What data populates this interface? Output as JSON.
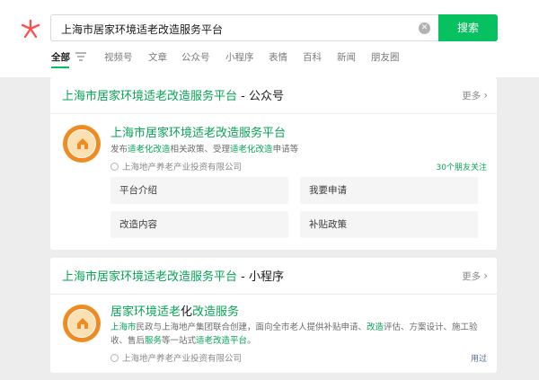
{
  "search": {
    "query": "上海市居家环境适老改造服务平台",
    "button_label": "搜索"
  },
  "tabs": [
    {
      "label": "全部",
      "active": true
    },
    {
      "label": "视频号"
    },
    {
      "label": "文章"
    },
    {
      "label": "公众号"
    },
    {
      "label": "小程序"
    },
    {
      "label": "表情"
    },
    {
      "label": "百科"
    },
    {
      "label": "新闻"
    },
    {
      "label": "朋友圈"
    }
  ],
  "official_account_card": {
    "header_highlight": "上海市居家环境适老改造服务平台",
    "header_suffix": " - 公众号",
    "more_label": "更多",
    "title": "上海市居家环境适老改造服务平台",
    "desc_parts": [
      "发布",
      "适老化改造",
      "相关政策、受理",
      "适老化改造",
      "申请等"
    ],
    "source": "上海地产养老产业投资有限公司",
    "friends_follow": "30个朋友关注",
    "services": [
      "平台介绍",
      "我要申请",
      "改造内容",
      "补贴政策"
    ]
  },
  "mini_program_card": {
    "header_highlight": "上海市居家环境适老改造服务平台",
    "header_suffix": " - 小程序",
    "more_label": "更多",
    "title_parts": [
      "居家环境适老",
      "化",
      "改造服务"
    ],
    "desc_parts": [
      "上海市",
      "民政与上海地产集团联合创建，面向全市老人提供补贴申请、",
      "改造",
      "评估、方案设计、施工验收、售后",
      "服务",
      "等一站式",
      "适老改造平台",
      "。"
    ],
    "source": "上海地产养老产业投资有限公司",
    "used_label": "用过"
  },
  "colors": {
    "brand_green": "#07c160",
    "highlight_green": "#07a356",
    "logo_red": "#fa5151",
    "avatar_orange": "#f08b21"
  }
}
